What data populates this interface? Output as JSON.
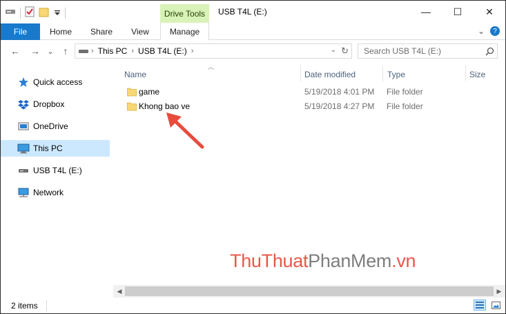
{
  "titlebar": {
    "context_tab": "Drive Tools",
    "title": "USB T4L (E:)",
    "minimize": "—",
    "maximize": "☐",
    "close": "✕"
  },
  "ribbon": {
    "tabs": [
      {
        "label": "File"
      },
      {
        "label": "Home"
      },
      {
        "label": "Share"
      },
      {
        "label": "View"
      },
      {
        "label": "Manage"
      }
    ],
    "expand_glyph": "⌄",
    "help_glyph": "?"
  },
  "address": {
    "crumbs": [
      "This PC",
      "USB T4L (E:)"
    ],
    "separator": "›",
    "search_placeholder": "Search USB T4L (E:)"
  },
  "nav": {
    "back": "←",
    "forward": "→",
    "recent": "⌄",
    "up": "↑"
  },
  "sidebar": {
    "items": [
      {
        "label": "Quick access",
        "icon": "star-icon"
      },
      {
        "label": "Dropbox",
        "icon": "dropbox-icon"
      },
      {
        "label": "OneDrive",
        "icon": "cloud-icon"
      },
      {
        "label": "This PC",
        "icon": "computer-icon",
        "selected": true
      },
      {
        "label": "USB T4L (E:)",
        "icon": "usb-drive-icon"
      },
      {
        "label": "Network",
        "icon": "network-icon"
      }
    ]
  },
  "files": {
    "columns": [
      "Name",
      "Date modified",
      "Type",
      "Size"
    ],
    "rows": [
      {
        "name": "game",
        "date": "5/19/2018 4:01 PM",
        "type": "File folder",
        "size": ""
      },
      {
        "name": "Khong bao ve",
        "date": "5/19/2018 4:27 PM",
        "type": "File folder",
        "size": ""
      }
    ]
  },
  "watermark": {
    "part1": "ThuThuat",
    "part2": "PhanMem",
    "part3": ".vn"
  },
  "status": {
    "item_count": "2 items"
  },
  "colors": {
    "file_tab": "#1979ca",
    "drive_tools": "#d9f2b8",
    "selection": "#cce8ff",
    "folder": "#f8d775",
    "arrow": "#e74c3c"
  }
}
